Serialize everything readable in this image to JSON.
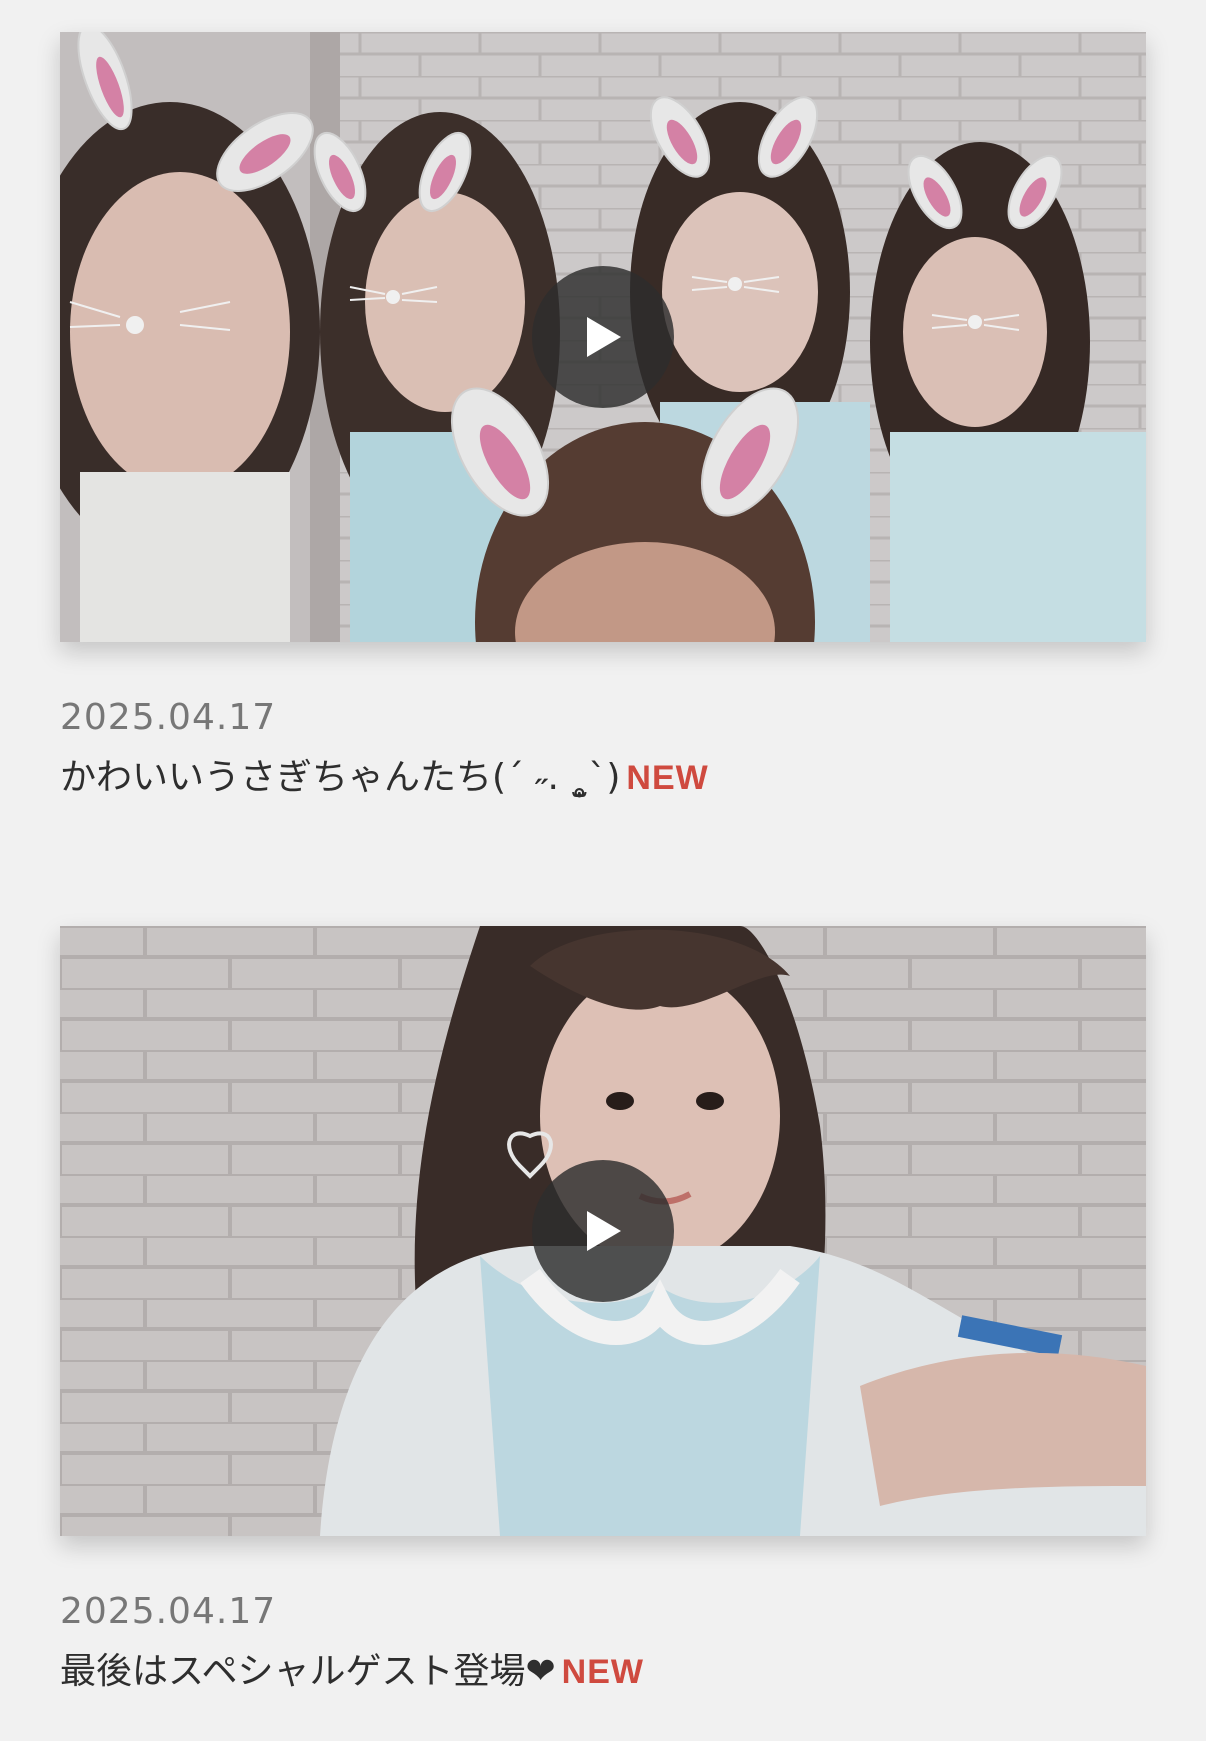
{
  "posts": [
    {
      "date": "2025.04.17",
      "title": "かわいいうさぎちゃんたち(ˊ ˶. ˳̫ˋ)",
      "badge": "NEW",
      "thumbnail": "group-photo-bunny-ears",
      "play_icon": "play-icon"
    },
    {
      "date": "2025.04.17",
      "title": "最後はスペシャルゲスト登場❤",
      "badge": "NEW",
      "thumbnail": "selfie-brick-wall",
      "play_icon": "play-icon"
    }
  ],
  "colors": {
    "background": "#f1f1f1",
    "date": "#777777",
    "title": "#2e2e2e",
    "badge": "#cf4a3f",
    "play_button": "#2d2d2d"
  }
}
